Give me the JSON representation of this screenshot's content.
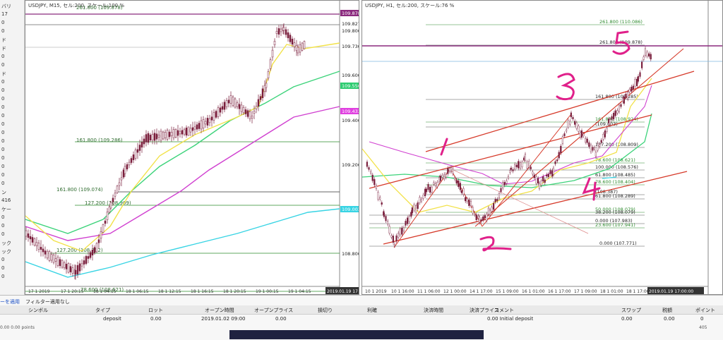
{
  "sidebar": {
    "labels": [
      "バリ",
      "17",
      "0",
      "0",
      "ド",
      "ド",
      "0",
      "0",
      "ド",
      "0",
      "0",
      "0",
      "0",
      "0",
      "0",
      "0",
      "0",
      "0",
      "0",
      "0",
      "0",
      "0",
      "ン",
      "416",
      "ケー",
      "0",
      "0",
      "0",
      "ック",
      "ック",
      "0",
      "0",
      "0"
    ]
  },
  "left_chart": {
    "title": "USDJPY, M15, セル:200, スケール:100 %",
    "price_labels": [
      "109.878",
      "109.827",
      "109.800",
      "109.730",
      "109.600",
      "109.556",
      "109.433",
      "109.400",
      "109.200",
      "109.003",
      "108.800"
    ],
    "fib_labels": [
      "261.800 (109.878)",
      "161.800 (109.286)",
      "161.800 (109.074)",
      "127.200 (108.909)",
      "127.200 (108.792)",
      "78.600 (108.621)"
    ],
    "time_labels": [
      "17 1 2019",
      "17 1 20:15",
      "18 1 04:15",
      "18 1 06:15",
      "18 1 12:15",
      "18 1 16:15",
      "18 1 20:15",
      "19 1 00:15",
      "19 1 04:15"
    ],
    "corner_time": "2019.01.19 17"
  },
  "right_chart": {
    "title": "USDJPY, H1, セル:200, スケール:76 %",
    "fib_labels": [
      "261.800 (110.086)",
      "261.800 (109.878)",
      "161.800 (109.285)",
      "161.800 (108.924)",
      "(109.003)",
      "127.200 (108.809)",
      "78.600 (108.621)",
      "100.000 (108.576)",
      "61.800 (108.485)",
      "78.600 (108.404)",
      "(108.387)",
      "61.800 (108.289)",
      "50.000 (108.079)",
      "38.200 (108.079)",
      "0.000 (107.983)",
      "23.600 (107.941)",
      "0.000 (107.771)"
    ],
    "time_labels": [
      "10 1 2019",
      "10 1 16:00",
      "11 1 06:00",
      "12 1 00:00",
      "14 1 17:00",
      "15 1 09:00",
      "16 1 01:00",
      "16 1 17:00",
      "17 1 09:00",
      "18 1 01:00",
      "18 1 17:00"
    ],
    "corner_time": "2019.01.19 17:00:00",
    "annotations": [
      "1",
      "2",
      "3",
      "4",
      "5"
    ]
  },
  "terminal": {
    "tabs": [
      "ーを適用",
      "フィルター適用なし"
    ],
    "columns": [
      "シンボル",
      "タイプ",
      "ロット",
      "オープン時間",
      "オープンプライス",
      "損切り",
      "利確",
      "決済時間",
      "決済プライス",
      "コメント",
      "スワップ",
      "税額",
      "ポイント"
    ],
    "row": {
      "type": "deposit",
      "lot": "0.00",
      "open_time": "2019.01.02 09:00",
      "price": "0.00",
      "comment": "0.00  Initial deposit",
      "swap": "0.00",
      "tax": "0.00",
      "point": "0"
    },
    "footer": "0.00  0.00 points",
    "total": "405"
  },
  "colors": {
    "candle": "#7a1f3d",
    "ma_yellow": "#f2e24a",
    "ma_green": "#3cd37a",
    "ma_magenta": "#d040d0",
    "ma_cyan": "#38d4e4",
    "channel_red": "#d63a2a",
    "pen_pink": "#e0208a",
    "fib_green": "#2e8b2e",
    "resistance": "#8b2a7e"
  }
}
